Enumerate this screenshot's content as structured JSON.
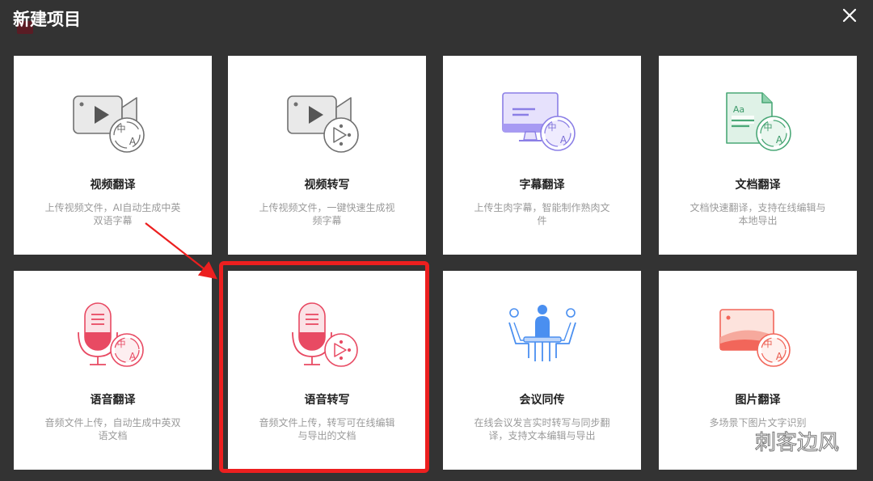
{
  "dialog": {
    "title": "新建项目",
    "close_icon": "close-icon"
  },
  "cards": [
    {
      "title": "视频翻译",
      "desc": "上传视频文件，AI自动生成中英双语字幕",
      "icon": "video-translate-icon"
    },
    {
      "title": "视频转写",
      "desc": "上传视频文件，一键快速生成视频字幕",
      "icon": "video-transcribe-icon"
    },
    {
      "title": "字幕翻译",
      "desc": "上传生肉字幕，智能制作熟肉文件",
      "icon": "subtitle-translate-icon"
    },
    {
      "title": "文档翻译",
      "desc": "文档快速翻译，支持在线编辑与本地导出",
      "icon": "document-translate-icon"
    },
    {
      "title": "语音翻译",
      "desc": "音频文件上传，自动生成中英双语文档",
      "icon": "speech-translate-icon"
    },
    {
      "title": "语音转写",
      "desc": "音频文件上传，转写可在线编辑与导出的文档",
      "icon": "speech-transcribe-icon"
    },
    {
      "title": "会议同传",
      "desc": "在线会议发言实时转写与同步翻译，支持文本编辑与导出",
      "icon": "meeting-interpretation-icon"
    },
    {
      "title": "图片翻译",
      "desc": "多场景下图片文字识别",
      "icon": "image-translate-icon"
    }
  ],
  "icon_glyphs": {
    "zh": "中",
    "a": "A",
    "aa": "Aa"
  },
  "colors": {
    "background": "#333333",
    "card": "#ffffff",
    "highlight": "#ec1f1f",
    "video_gray": "#e9e9e9",
    "subtitle_purple": "#a79af3",
    "doc_green": "#5dbd8c",
    "speech_red": "#e84a63",
    "meeting_blue": "#4a8ff0",
    "image_orange": "#f2665a"
  },
  "watermark": {
    "text": "刺客边风",
    "icon": "wechat-icon"
  }
}
